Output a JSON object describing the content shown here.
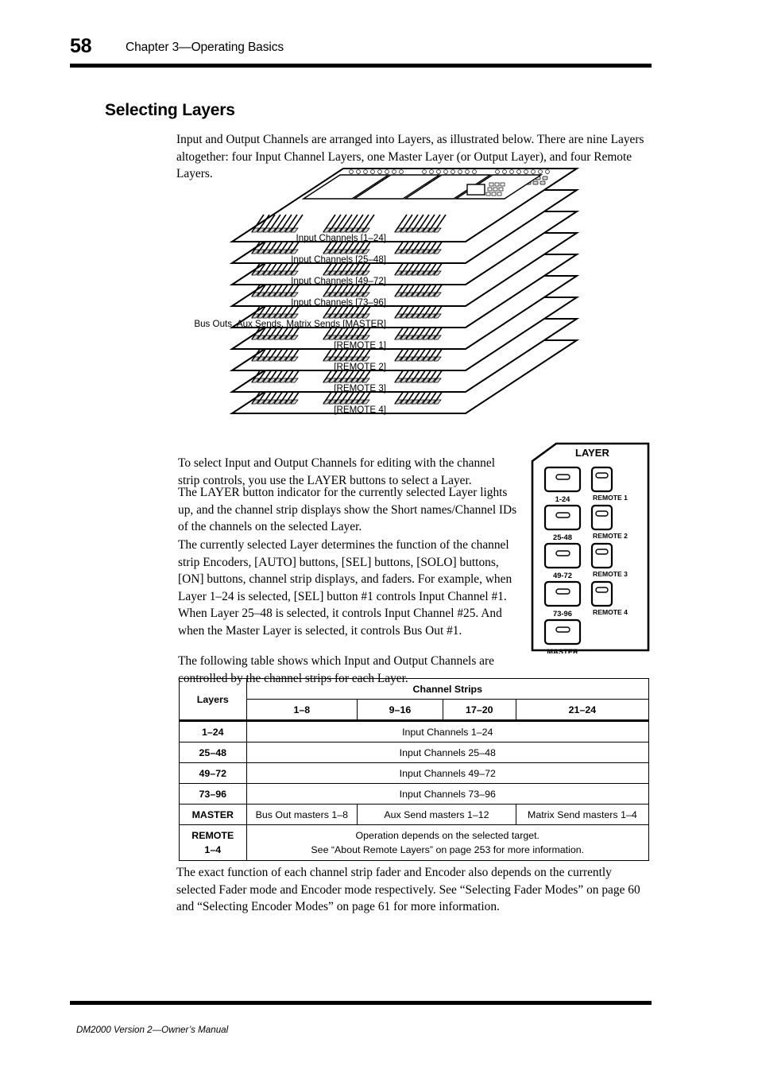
{
  "header": {
    "page_number": "58",
    "chapter_title": "Chapter 3—Operating Basics"
  },
  "section": {
    "heading": "Selecting Layers",
    "intro": "Input and Output Channels are arranged into Layers, as illustrated below. There are nine Layers altogether: four Input Channel Layers, one Master Layer (or Output Layer), and four Remote Layers.",
    "para_1": "To select Input and Output Channels for editing with the channel strip controls, you use the LAYER buttons to select a Layer.",
    "para_2": "The LAYER button indicator for the currently selected Layer lights up, and the channel strip displays show the Short names/Channel IDs of the channels on the selected Layer.",
    "para_3": "The currently selected Layer determines the function of the channel strip Encoders, [AUTO] buttons, [SEL] buttons, [SOLO] buttons, [ON] buttons, channel strip displays, and faders. For example, when Layer 1–24 is selected, [SEL] button  #1 controls Input Channel #1. When Layer 25–48 is selected, it controls Input Channel #25. And when the Master Layer is selected, it controls Bus Out #1.",
    "para_4": "The following table shows which Input and Output Channels are controlled by the channel strips for each Layer.",
    "closing": "The exact function of each channel strip fader and Encoder also depends on the currently selected Fader mode and Encoder mode respectively. See “Selecting Fader Modes” on page 60 and “Selecting Encoder Modes” on page 61 for more information."
  },
  "diagram": {
    "labels": [
      "Input Channels [1–24]",
      "Input Channels [25–48]",
      "Input Channels [49–72]",
      "Input Channels [73–96]",
      "Bus Outs, Aux Sends, Matrix Sends [MASTER]",
      "[REMOTE 1]",
      "[REMOTE 2]",
      "[REMOTE 3]",
      "[REMOTE 4]"
    ]
  },
  "layer_panel": {
    "title": "LAYER",
    "left_buttons": [
      {
        "label": "1-24"
      },
      {
        "label": "25-48"
      },
      {
        "label": "49-72"
      },
      {
        "label": "73-96"
      },
      {
        "label": "MASTER"
      }
    ],
    "right_buttons": [
      {
        "label": "REMOTE 1"
      },
      {
        "label": "REMOTE 2"
      },
      {
        "label": "REMOTE 3"
      },
      {
        "label": "REMOTE 4"
      }
    ]
  },
  "table": {
    "corner_header": "Layers",
    "group_header": "Channel Strips",
    "strip_headers": [
      "1–8",
      "9–16",
      "17–20",
      "21–24"
    ],
    "rows": [
      {
        "layer": "1–24",
        "cells": [
          "Input Channels 1–24"
        ]
      },
      {
        "layer": "25–48",
        "cells": [
          "Input Channels 25–48"
        ]
      },
      {
        "layer": "49–72",
        "cells": [
          "Input Channels 49–72"
        ]
      },
      {
        "layer": "73–96",
        "cells": [
          "Input Channels 73–96"
        ]
      },
      {
        "layer": "MASTER",
        "cells": [
          "Bus Out masters 1–8",
          "Aux Send masters 1–12",
          "Matrix Send masters 1–4"
        ]
      },
      {
        "layer": "REMOTE 1–4",
        "layer_line1": "REMOTE",
        "layer_line2": "1–4",
        "cells_line1": "Operation depends on the selected target.",
        "cells_line2": "See “About Remote Layers” on page 253 for more information."
      }
    ]
  },
  "footer": {
    "text": "DM2000 Version 2—Owner’s Manual"
  }
}
